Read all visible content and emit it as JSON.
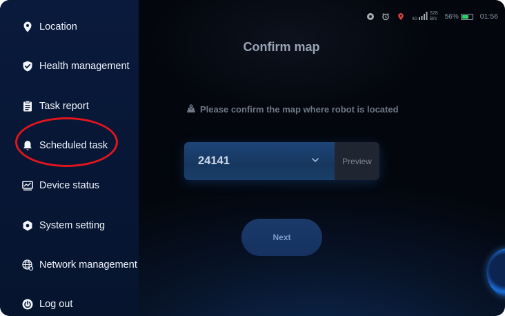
{
  "sidebar": {
    "items": [
      {
        "label": "Location",
        "icon": "location-pin-icon"
      },
      {
        "label": "Health management",
        "icon": "shield-check-icon"
      },
      {
        "label": "Task report",
        "icon": "clipboard-icon"
      },
      {
        "label": "Scheduled task",
        "icon": "bell-icon"
      },
      {
        "label": "Device status",
        "icon": "chart-monitor-icon"
      },
      {
        "label": "System setting",
        "icon": "settings-hexagon-icon"
      },
      {
        "label": "Network management",
        "icon": "globe-icon"
      },
      {
        "label": "Log out",
        "icon": "power-icon"
      }
    ]
  },
  "statusbar": {
    "signal_label": "4G",
    "net_speed_value": "528",
    "net_speed_unit": "B/s",
    "battery_percent_label": "56%",
    "battery_level": 0.56,
    "time": "01:56"
  },
  "main": {
    "title": "Confirm map",
    "prompt": "Please confirm the map where robot is located",
    "map_selector": {
      "selected_value": "24141",
      "preview_label": "Preview"
    },
    "next_label": "Next"
  },
  "colors": {
    "annotation": "#e2151d",
    "sidebar_bg": "#071634",
    "accent_blue": "#1d4477",
    "battery_green": "#2ed06a"
  }
}
